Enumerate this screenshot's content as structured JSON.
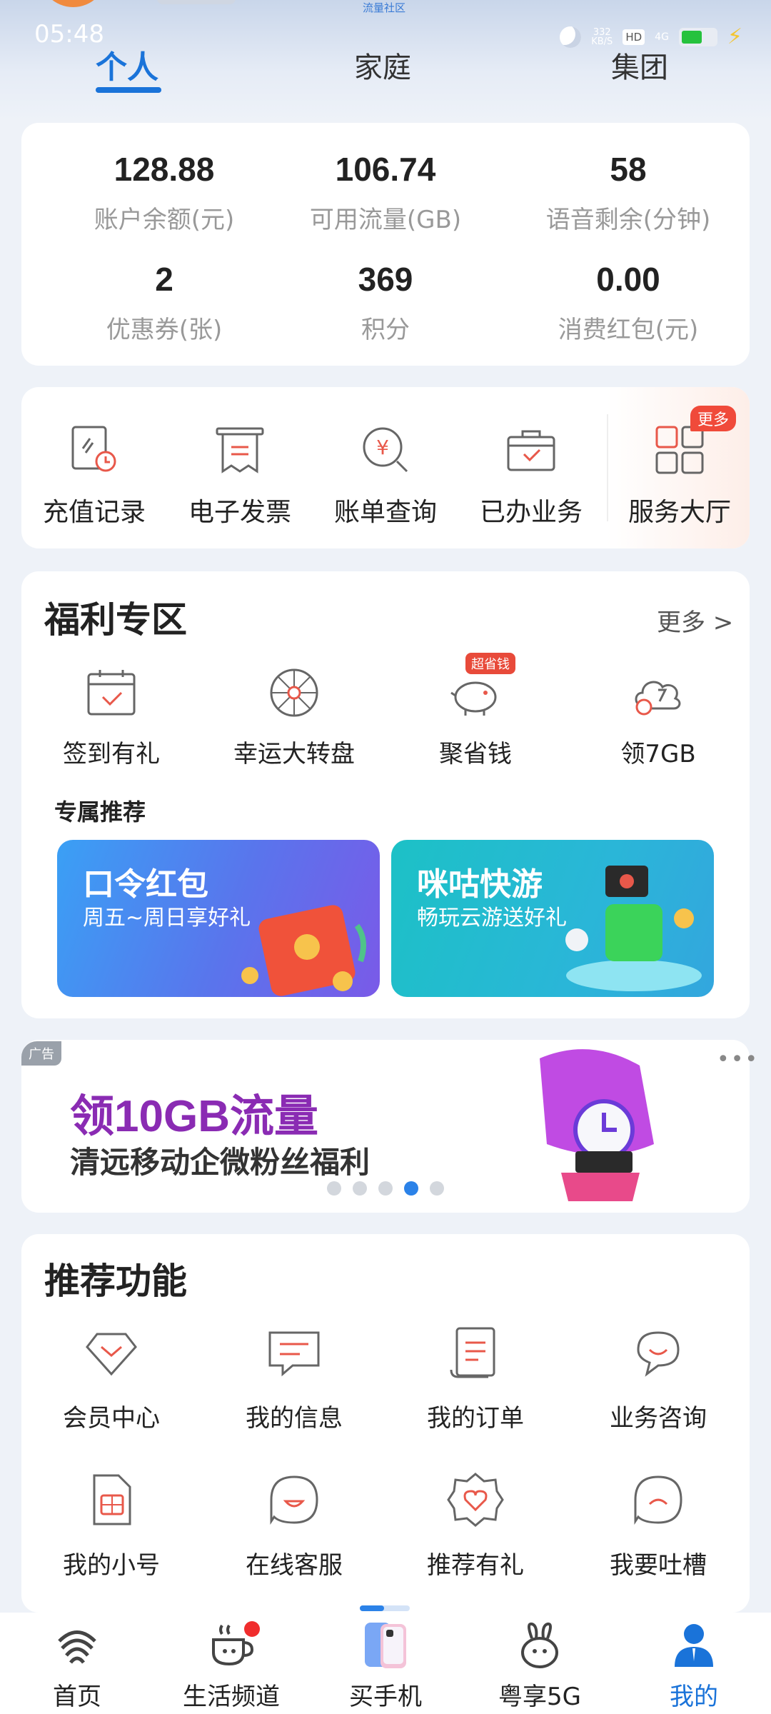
{
  "status_bar": {
    "time": "05:48",
    "net_speed_top": "332",
    "net_speed_unit": "KB/S",
    "hd": "HD",
    "network": "4G"
  },
  "header": {
    "community_label": "流量社区"
  },
  "tabs": [
    {
      "label": "个人",
      "active": true
    },
    {
      "label": "家庭"
    },
    {
      "label": "集团"
    }
  ],
  "account_stats": [
    {
      "value": "128.88",
      "label": "账户余额(元)"
    },
    {
      "value": "106.74",
      "label": "可用流量(GB)"
    },
    {
      "value": "58",
      "label": "语音剩余(分钟)"
    },
    {
      "value": "2",
      "label": "优惠券(张)"
    },
    {
      "value": "369",
      "label": "积分"
    },
    {
      "value": "0.00",
      "label": "消费红包(元)"
    }
  ],
  "quick_actions": [
    {
      "label": "充值记录",
      "icon": "recharge-record-icon"
    },
    {
      "label": "电子发票",
      "icon": "invoice-icon"
    },
    {
      "label": "账单查询",
      "icon": "bill-query-icon"
    },
    {
      "label": "已办业务",
      "icon": "briefcase-icon"
    },
    {
      "label": "服务大厅",
      "icon": "service-hall-icon",
      "badge": "更多"
    }
  ],
  "welfare": {
    "title": "福利专区",
    "more": "更多 >",
    "items": [
      {
        "label": "签到有礼",
        "icon": "calendar-check-icon"
      },
      {
        "label": "幸运大转盘",
        "icon": "wheel-icon"
      },
      {
        "label": "聚省钱",
        "icon": "piggy-bank-icon",
        "tag": "超省钱"
      },
      {
        "label": "领7GB",
        "icon": "cloud-data-icon"
      }
    ],
    "exclusive_title": "专属推荐",
    "banners": [
      {
        "title": "口令红包",
        "subtitle": "周五~周日享好礼"
      },
      {
        "title": "咪咕快游",
        "subtitle": "畅玩云游送好礼"
      }
    ]
  },
  "ad": {
    "tag": "广告",
    "title": "领10GB流量",
    "subtitle": "清远移动企微粉丝福利",
    "dots_total": 5,
    "dots_active_index": 3
  },
  "recommended": {
    "title": "推荐功能",
    "items": [
      {
        "label": "会员中心",
        "icon": "member-diamond-icon"
      },
      {
        "label": "我的信息",
        "icon": "message-icon"
      },
      {
        "label": "我的订单",
        "icon": "order-icon"
      },
      {
        "label": "业务咨询",
        "icon": "consult-icon"
      },
      {
        "label": "我的小号",
        "icon": "sim-card-icon"
      },
      {
        "label": "在线客服",
        "icon": "customer-service-icon"
      },
      {
        "label": "推荐有礼",
        "icon": "heart-badge-icon"
      },
      {
        "label": "我要吐槽",
        "icon": "complaint-icon"
      }
    ]
  },
  "bottom_nav": [
    {
      "label": "首页",
      "icon": "china-mobile-logo-icon"
    },
    {
      "label": "生活频道",
      "icon": "coffee-cup-icon"
    },
    {
      "label": "买手机",
      "icon": "phone-icon"
    },
    {
      "label": "粤享5G",
      "icon": "rabbit-icon"
    },
    {
      "label": "我的",
      "icon": "user-icon",
      "active": true
    }
  ],
  "colors": {
    "accent": "#1a73d9",
    "red": "#e84a3a",
    "icon_red": "#e8584a",
    "icon_gray": "#666666",
    "ad_purple": "#8a2bb3"
  }
}
